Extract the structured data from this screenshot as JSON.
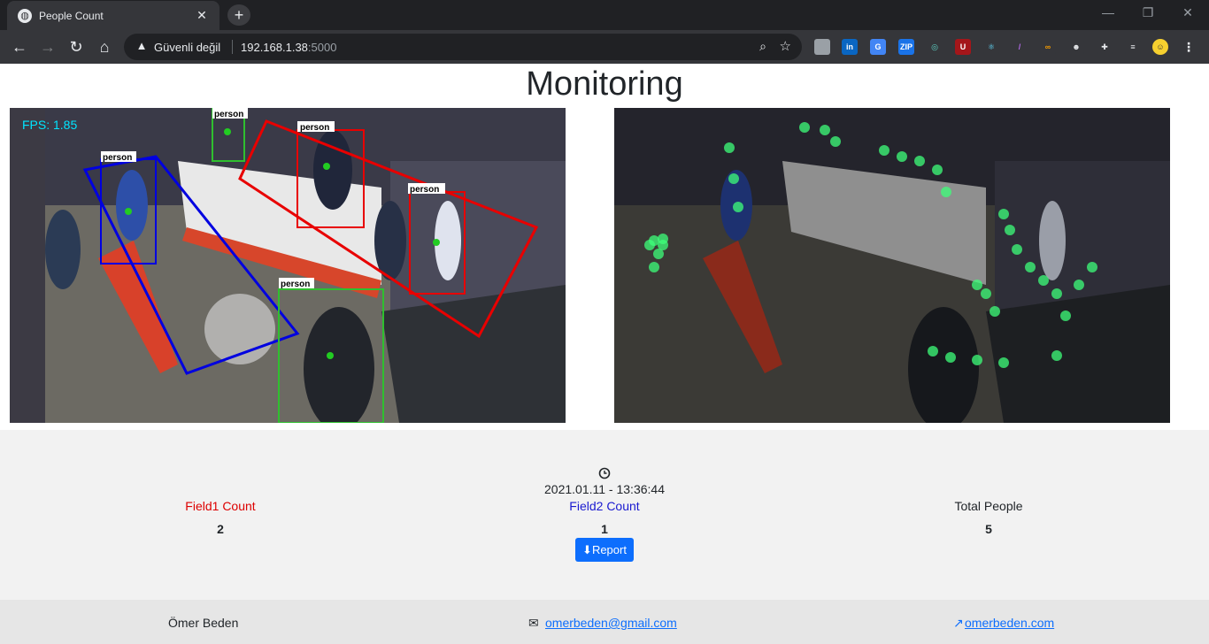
{
  "browser": {
    "tab_title": "People Count",
    "security_label": "Güvenli değil",
    "url_host": "192.168.1.38",
    "url_port": ":5000"
  },
  "page": {
    "title": "Monitoring"
  },
  "left_feed": {
    "overlay_text": "FPS: 1.85",
    "detections": [
      "person",
      "person",
      "person",
      "person",
      "person"
    ]
  },
  "stats": {
    "datetime": "2021.01.11 - 13:36:44",
    "field1_label": "Field1 Count",
    "field1_value": "2",
    "field2_label": "Field2 Count",
    "field2_value": "1",
    "total_label": "Total People",
    "total_value": "5",
    "report_label": "Report",
    "colors": {
      "field1": "#dd0000",
      "field2": "#1a1ad0",
      "total": "#212529"
    }
  },
  "footer": {
    "author": "Ömer Beden",
    "email": "omerbeden@gmail.com",
    "website": "omerbeden.com"
  }
}
